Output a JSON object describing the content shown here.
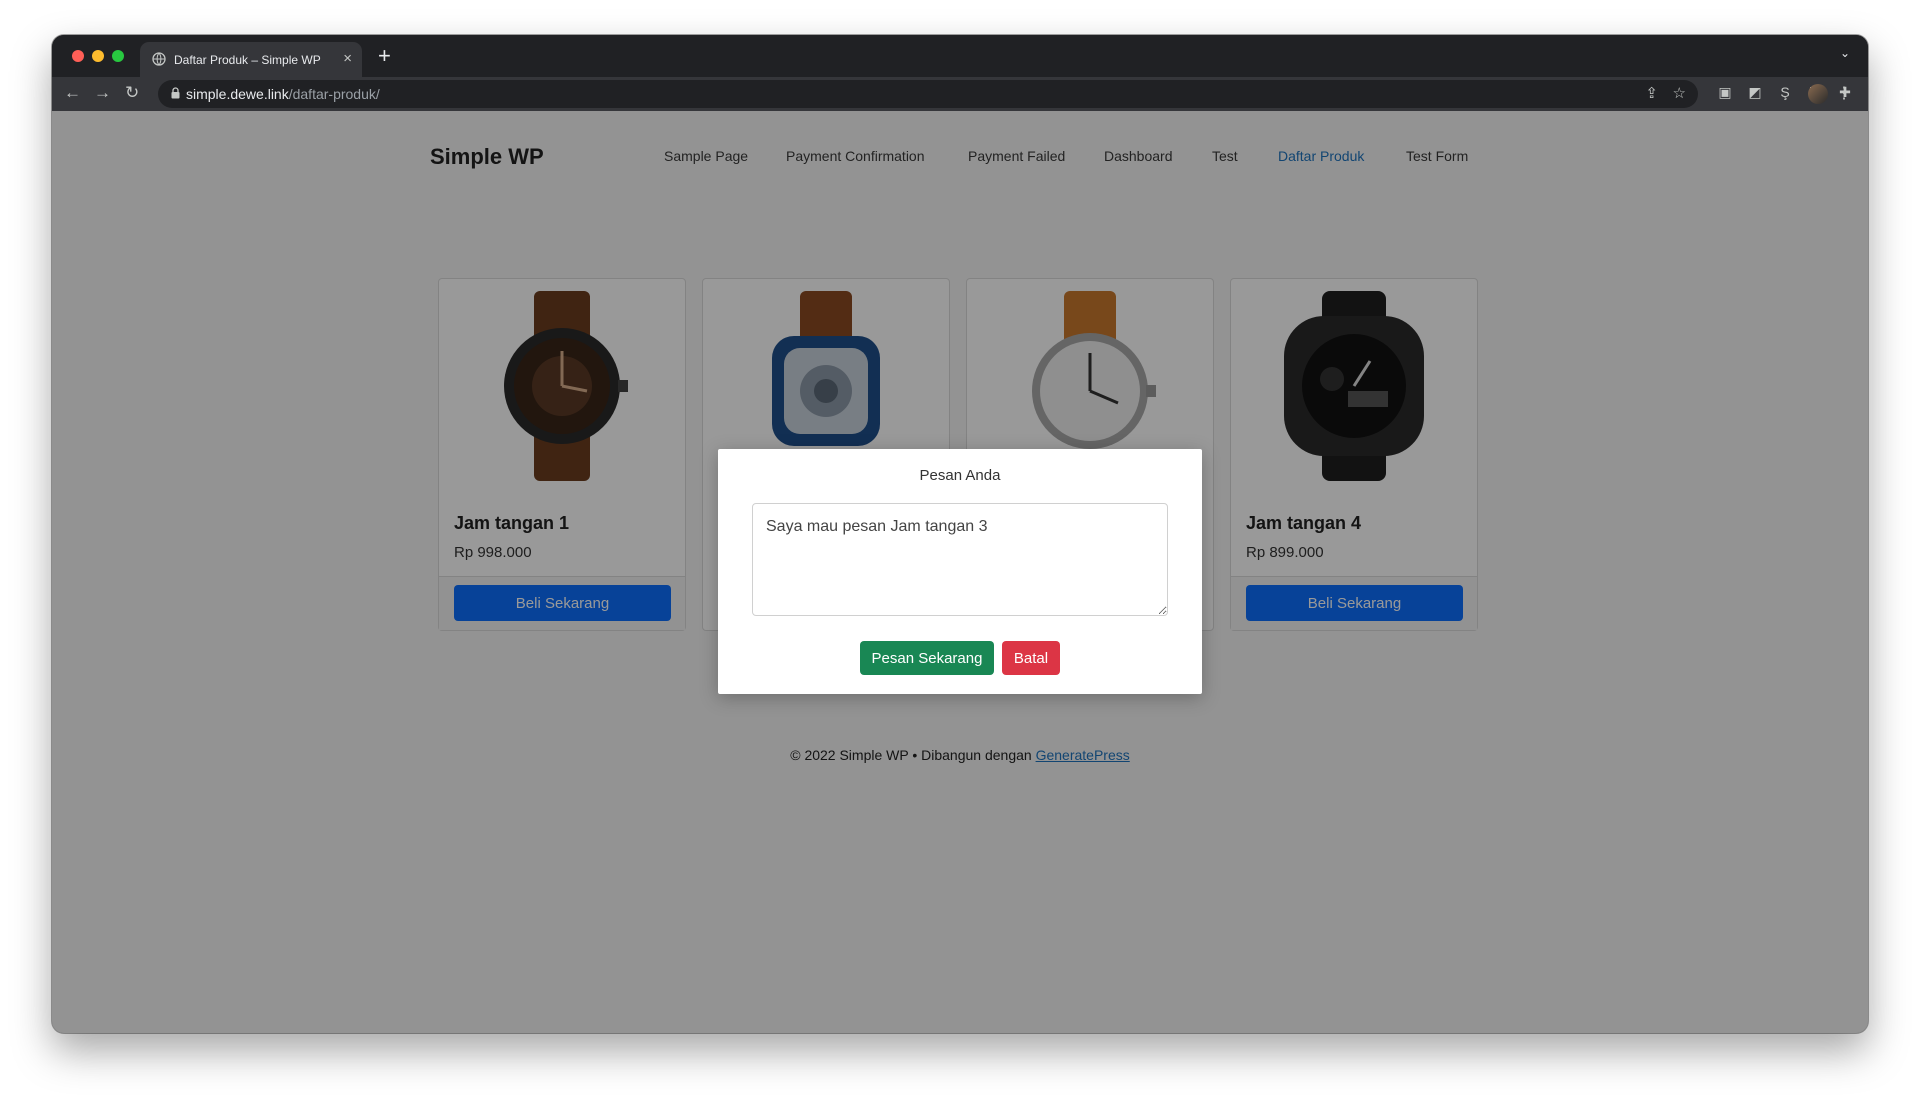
{
  "browser": {
    "tab_title": "Daftar Produk – Simple WP",
    "url_host": "simple.dewe.link",
    "url_path": "/daftar-produk/"
  },
  "site": {
    "title": "Simple WP",
    "nav": [
      {
        "label": "Sample Page",
        "active": false
      },
      {
        "label": "Payment Confirmation",
        "active": false
      },
      {
        "label": "Payment Failed",
        "active": false
      },
      {
        "label": "Dashboard",
        "active": false
      },
      {
        "label": "Test",
        "active": false
      },
      {
        "label": "Daftar Produk",
        "active": true
      },
      {
        "label": "Test Form",
        "active": false
      }
    ]
  },
  "products": [
    {
      "name": "Jam tangan 1",
      "price": "Rp 998.000",
      "button": "Beli Sekarang",
      "image": "brown-leather-skeleton-watch"
    },
    {
      "name": "",
      "price": "",
      "button": "",
      "image": "blue-square-skeleton-watch"
    },
    {
      "name": "",
      "price": "",
      "button": "",
      "image": "silver-timex-field-watch"
    },
    {
      "name": "Jam tangan 4",
      "price": "Rp 899.000",
      "button": "Beli Sekarang",
      "image": "black-gshock-watch"
    }
  ],
  "modal": {
    "title": "Pesan Anda",
    "message": "Saya mau pesan Jam tangan 3",
    "order_button": "Pesan Sekarang",
    "cancel_button": "Batal"
  },
  "footer": {
    "text": "© 2022 Simple WP • Dibangun dengan ",
    "link": "GeneratePress"
  },
  "colors": {
    "primary": "#0d6efd",
    "success": "#198754",
    "danger": "#dc3545",
    "nav_active": "#1e73be"
  }
}
